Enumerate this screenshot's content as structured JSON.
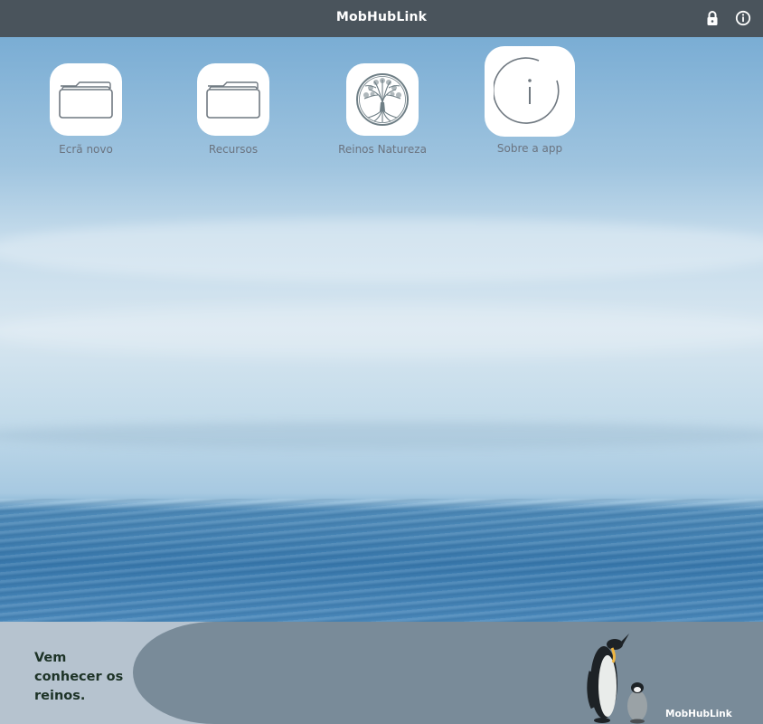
{
  "header": {
    "title": "MobHubLink",
    "icons": [
      "lock-icon",
      "info-icon"
    ],
    "background": "#4a545c"
  },
  "apps": [
    {
      "label": "Ecrã novo",
      "icon": "folder-icon"
    },
    {
      "label": "Recursos",
      "icon": "folder-icon"
    },
    {
      "label": "Reinos Natureza",
      "icon": "tree-of-life-icon"
    },
    {
      "label": "Sobre a app",
      "icon": "info-icon"
    }
  ],
  "footer": {
    "slogan": "Vem conhecer os reinos.",
    "brand": "MobHubLink",
    "image": "penguins",
    "colors": {
      "left": "#b6c3cf",
      "right": "#798b99",
      "slogan": "#1d3327"
    }
  }
}
